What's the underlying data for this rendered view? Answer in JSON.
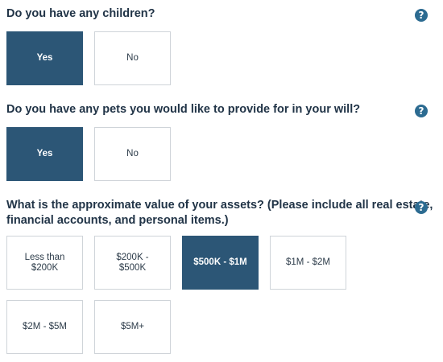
{
  "questions": [
    {
      "title": "Do you have any children?",
      "help_icon": "question-circle-icon",
      "options": [
        {
          "label": "Yes",
          "selected": true
        },
        {
          "label": "No",
          "selected": false
        }
      ]
    },
    {
      "title": "Do you have any pets you would like to provide for in your will?",
      "help_icon": "question-circle-icon",
      "options": [
        {
          "label": "Yes",
          "selected": true
        },
        {
          "label": "No",
          "selected": false
        }
      ]
    },
    {
      "title_line1": "What is the approximate value of your assets? (Please include all real estate,",
      "title_line2": "financial accounts, and personal items.)",
      "help_icon": "question-circle-icon",
      "options": [
        {
          "label_line1": "Less than",
          "label_line2": "$200K",
          "selected": false
        },
        {
          "label_line1": "$200K -",
          "label_line2": "$500K",
          "selected": false
        },
        {
          "label": "$500K - $1M",
          "selected": true
        },
        {
          "label": "$1M - $2M",
          "selected": false
        },
        {
          "label": "$2M - $5M",
          "selected": false
        },
        {
          "label": "$5M+",
          "selected": false
        }
      ]
    }
  ],
  "help_icon_glyph": "?",
  "colors": {
    "selected_bg": "#2c5676",
    "help_icon_bg": "#2c6b91",
    "title_text": "#213447",
    "border": "#cfd4d9"
  }
}
